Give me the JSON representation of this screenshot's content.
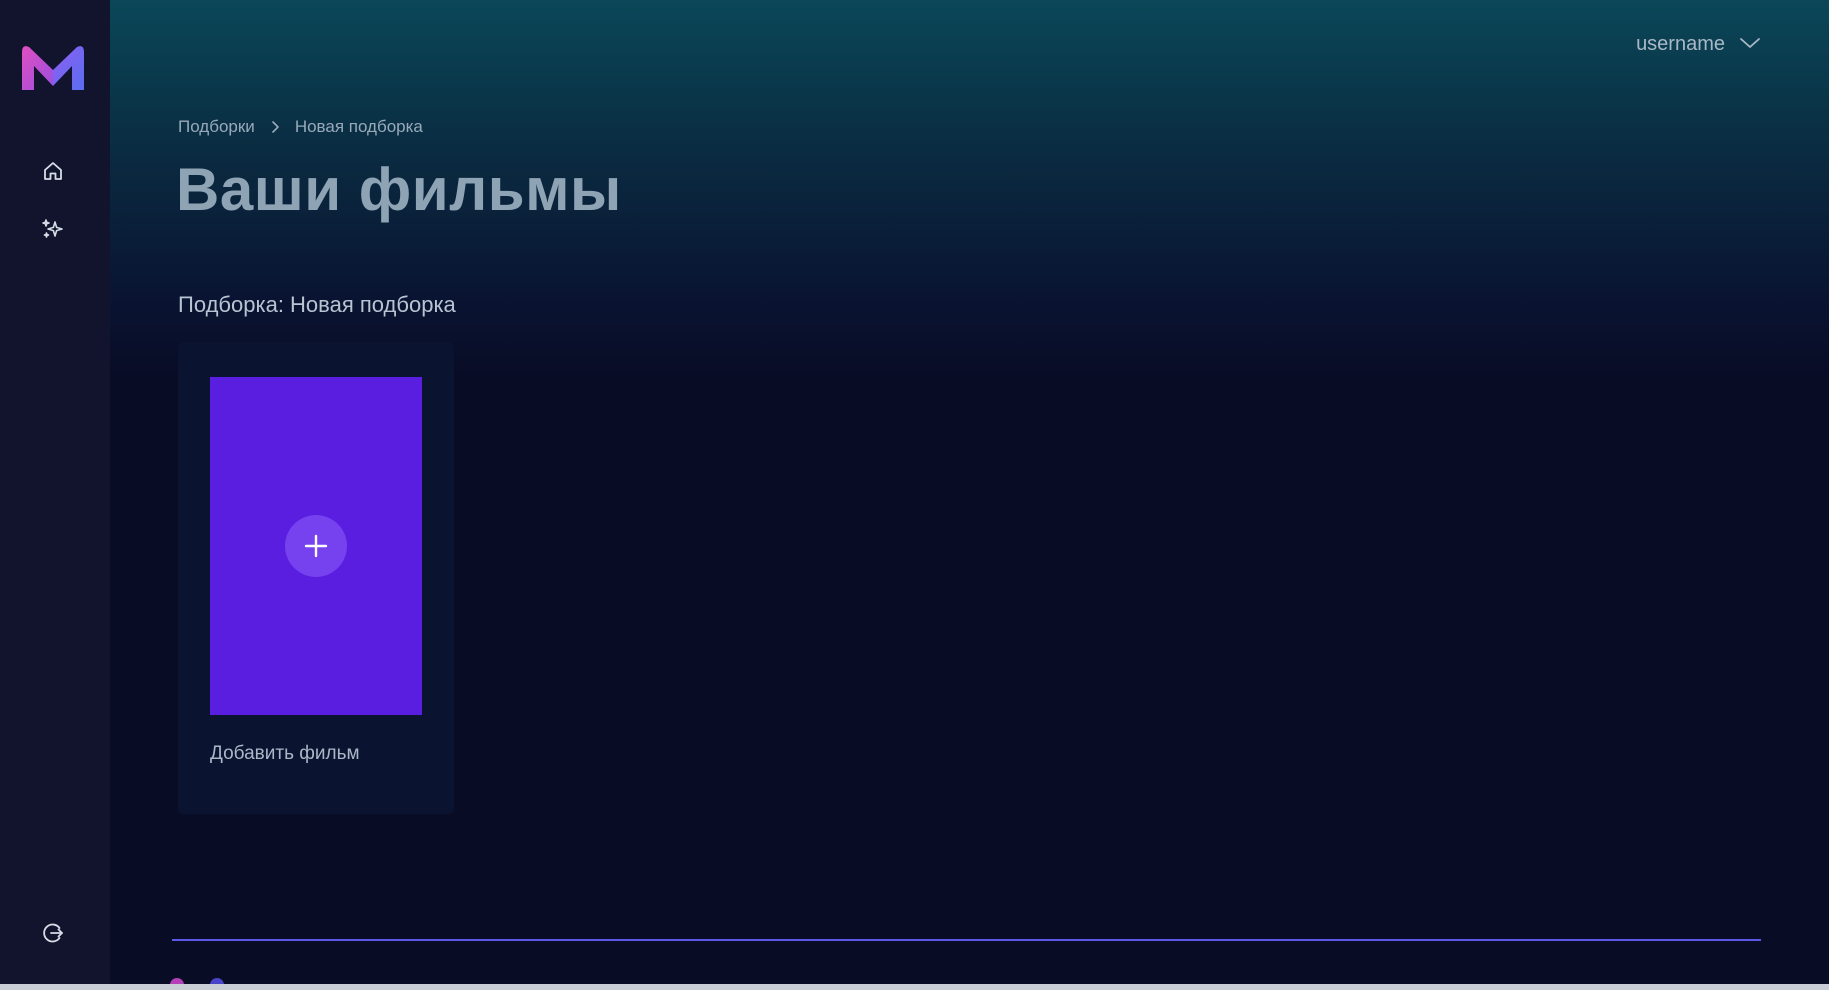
{
  "user": {
    "name": "username"
  },
  "breadcrumb": {
    "items": [
      "Подборки",
      "Новая подборка"
    ]
  },
  "page": {
    "title": "Ваши фильмы"
  },
  "collection": {
    "heading": "Подборка: Новая подборка",
    "add_card_label": "Добавить фильм"
  },
  "icons": {
    "logo": "logo-m-icon",
    "home": "home-icon",
    "recommend": "sparkles-icon",
    "logout": "logout-icon",
    "user_menu": "chevron-down-icon",
    "breadcrumb_sep": "chevron-right-icon",
    "add": "plus-icon"
  },
  "colors": {
    "sidebar_bg": "#12142e",
    "page_bg": "#090c25",
    "accent": "#5a1ee0",
    "accent_light": "#7641ef",
    "divider": "#5b57e6",
    "logo_pink": "#e04fc0",
    "logo_blue": "#6a5ef0"
  }
}
